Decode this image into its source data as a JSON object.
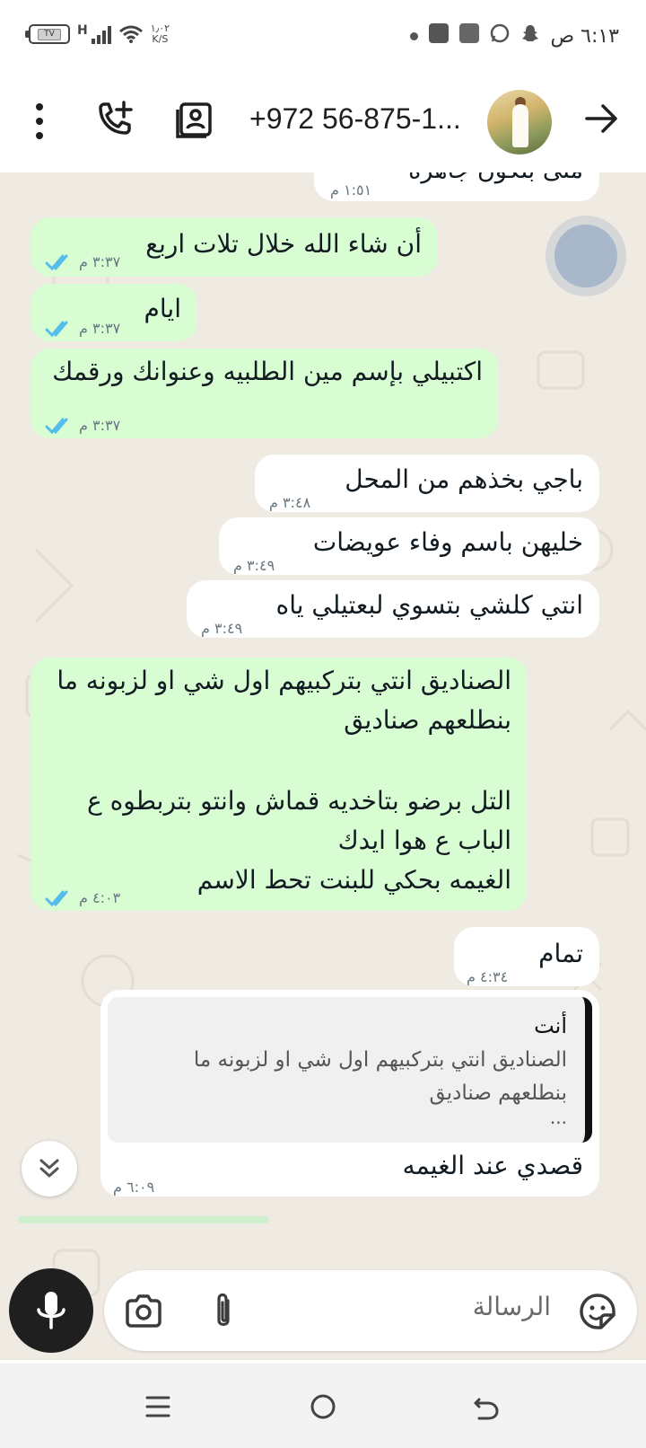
{
  "status_bar": {
    "time": "٦:١٣ ص",
    "network_type": "H",
    "speed": "١٫٠٢",
    "speed_unit": "K/S",
    "battery_level": "TV",
    "notification_icons": [
      "snapchat-icon",
      "whatsapp-icon",
      "sim-icon",
      "facebook-icon",
      "dot-icon"
    ]
  },
  "header": {
    "contact_name": "+972 56-875-1...",
    "icons": [
      "back-arrow-icon",
      "avatar",
      "contact-card-icon",
      "add-call-icon",
      "more-options-icon"
    ]
  },
  "messages": [
    {
      "dir": "in",
      "text": "متى بتكون جاهزة",
      "time": "١:٥١ م",
      "partial": true
    },
    {
      "dir": "out",
      "text": "أن شاء الله خلال تلات اربع",
      "time": "٣:٣٧ م",
      "read": true
    },
    {
      "dir": "out",
      "text": "ايام",
      "time": "٣:٣٧ م",
      "read": true
    },
    {
      "dir": "out",
      "text": "اكتبيلي بإسم مين الطلبيه وعنوانك ورقمك",
      "time": "٣:٣٧ م",
      "read": true
    },
    {
      "dir": "in",
      "text": "باجي بخذهم من المحل",
      "time": "٣:٤٨ م"
    },
    {
      "dir": "in",
      "text": "خليهن باسم وفاء عويضات",
      "time": "٣:٤٩ م"
    },
    {
      "dir": "in",
      "text": "انتي كلشي بتسوي لبعتيلي ياه",
      "time": "٣:٤٩ م"
    },
    {
      "dir": "out",
      "lines": [
        "الصناديق انتي بتركبيهم اول شي او لزبونه ما",
        "بنطلعهم صناديق",
        "",
        "التل برضو بتاخديه قماش وانتو بتربطوه ع",
        "الباب ع هوا ايدك",
        "الغيمه بحكي للبنت تحط الاسم"
      ],
      "time": "٤:٠٣ م",
      "read": true
    },
    {
      "dir": "in",
      "text": "تمام",
      "time": "٤:٣٤ م"
    },
    {
      "dir": "in",
      "quote": {
        "author": "أنت",
        "lines": [
          "الصناديق انتي بتركبيهم اول شي او لزبونه ما",
          "بنطلعهم صناديق",
          "..."
        ]
      },
      "text": "قصدي عند الغيمه",
      "time": "٦:٠٩ م"
    }
  ],
  "composer": {
    "placeholder": "الرسالة",
    "icons": [
      "sticker-icon",
      "attach-icon",
      "camera-icon",
      "mic-icon"
    ]
  },
  "nav": {
    "icons": [
      "recents-icon",
      "home-icon",
      "back-icon"
    ]
  },
  "colors": {
    "outgoing": "#d9fdd3",
    "incoming": "#ffffff",
    "chat_bg": "#efeae2",
    "read_ticks": "#53bdeb"
  }
}
